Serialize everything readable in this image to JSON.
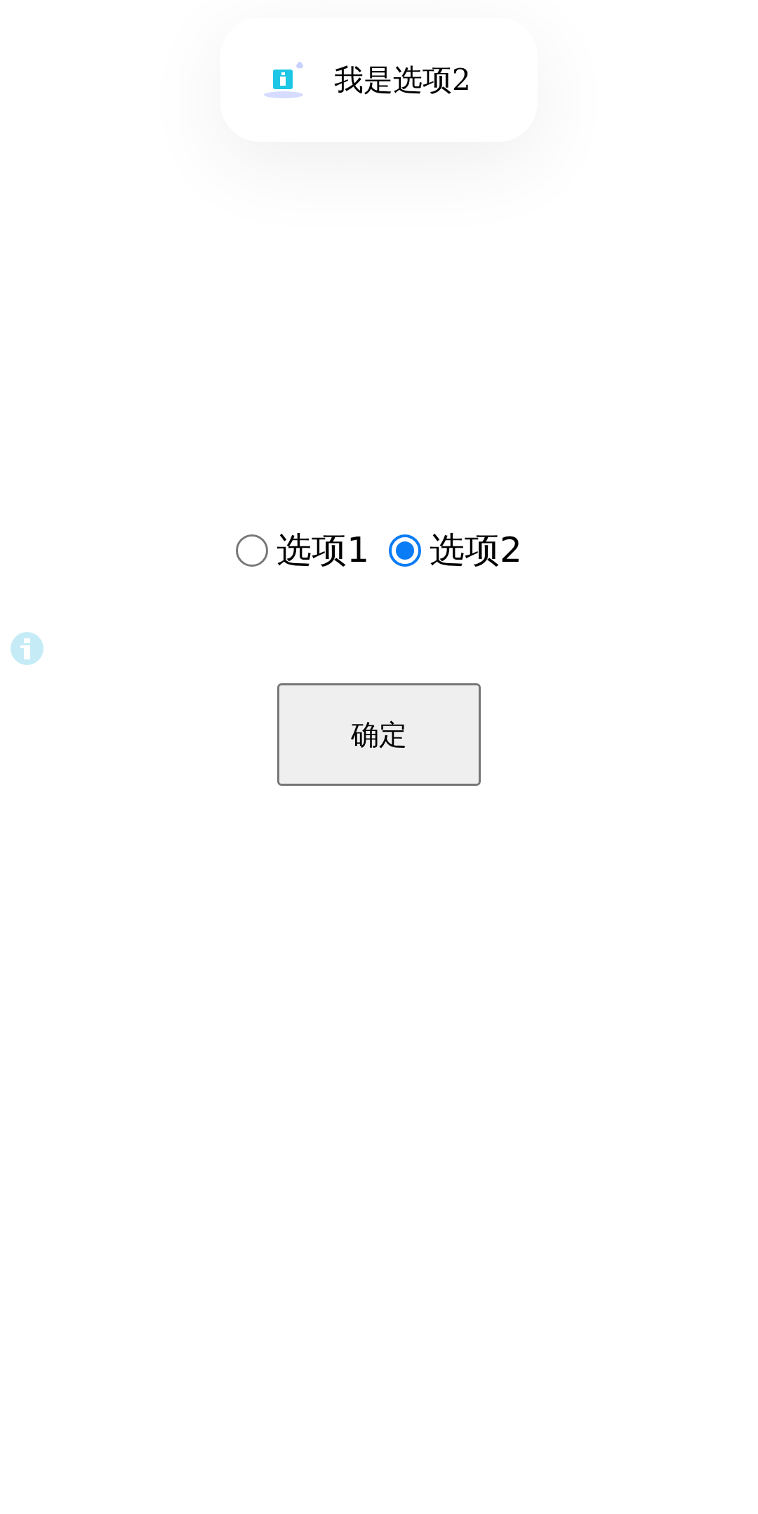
{
  "toast": {
    "message": "我是选项2"
  },
  "radio_group": [
    {
      "label": "选项1",
      "selected": false
    },
    {
      "label": "选项2",
      "selected": true
    }
  ],
  "confirm_button": {
    "label": "确定"
  }
}
